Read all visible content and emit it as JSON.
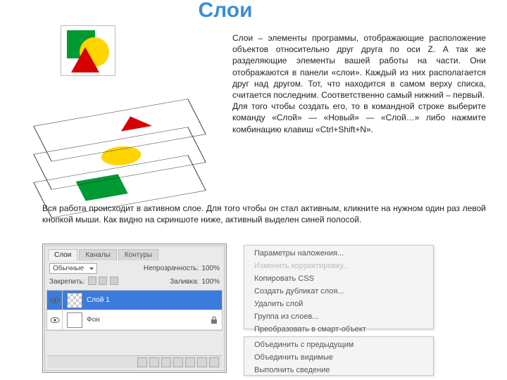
{
  "title": "Слои",
  "paragraphs": {
    "top": "Слои – элементы программы, отображающие расположение объектов относительно друг друга по оси Z. А так же разделяющие элементы вашей работы на части. Они отображаются в панели «слои». Каждый из них располагается друг над другом. Тот, что находится в самом верху списка, считается последним. Соответственно самый нижний – первый.\nДля того чтобы создать его, то в командной строке выберите команду «Слой» — «Новый» — «Слой…» либо нажмите комбинацию клавиш «Ctrl+Shift+N».",
    "bottom": "Вся работа происходит в активном слое. Для того чтобы он стал активным, кликните на нужном один раз левой кнопкой мыши. Как видно на скриншоте ниже, активный выделен синей полосой."
  },
  "layers_panel": {
    "tabs": [
      "Слои",
      "Каналы",
      "Контуры"
    ],
    "blend_mode": "Обычные",
    "opacity_label": "Непрозрачность:",
    "opacity_value": "100%",
    "lock_label": "Закрепить:",
    "fill_label": "Заливка:",
    "fill_value": "100%",
    "layers": [
      {
        "name": "Слой 1",
        "active": true,
        "locked": false
      },
      {
        "name": "Фон",
        "active": false,
        "locked": true
      }
    ]
  },
  "context_menu_top": [
    {
      "label": "Параметры наложения...",
      "disabled": false
    },
    {
      "label": "Изменить корректировку...",
      "disabled": true
    },
    {
      "label": "Копировать CSS",
      "disabled": false
    },
    {
      "label": "Создать дубликат слоя...",
      "disabled": false
    },
    {
      "label": "Удалить слой",
      "disabled": false
    },
    {
      "label": "Группа из слоев...",
      "disabled": false
    },
    {
      "label": "Преобразовать в смарт-объект",
      "disabled": false
    }
  ],
  "context_menu_bottom": [
    {
      "label": "Объединить с предыдущим",
      "disabled": false
    },
    {
      "label": "Объединить видимые",
      "disabled": false
    },
    {
      "label": "Выполнить сведение",
      "disabled": false
    }
  ]
}
